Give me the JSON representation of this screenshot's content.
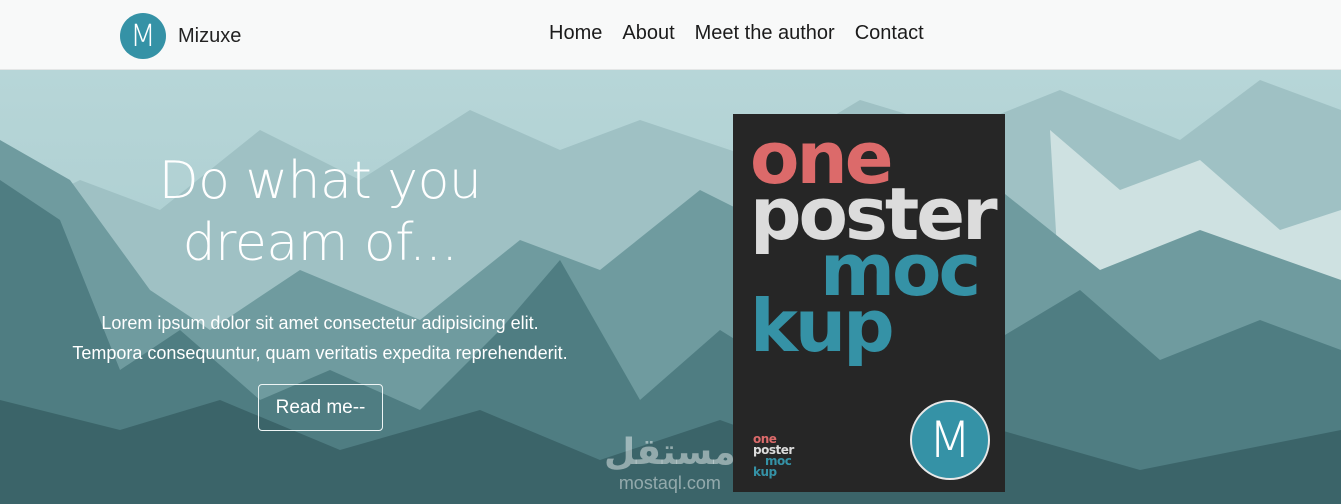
{
  "header": {
    "logo_letter": "M",
    "brand": "Mizuxe",
    "nav": [
      "Home",
      "About",
      "Meet the author",
      "Contact"
    ]
  },
  "hero": {
    "title_line1": "Do what you",
    "title_line2": "dream of...",
    "text_line1": "Lorem ipsum dolor sit amet consectetur adipisicing elit.",
    "text_line2": "Tempora consequuntur, quam veritatis expedita reprehenderit.",
    "button": "Read me--"
  },
  "poster": {
    "words": [
      "one",
      "poster",
      "moc",
      "kup"
    ],
    "logo_letter": "M"
  },
  "watermark": {
    "arabic": "مستقل",
    "latin": "mostaql.com"
  },
  "colors": {
    "accent": "#3592a6",
    "poster_red": "#dc6a6a",
    "poster_bg": "#262626"
  }
}
